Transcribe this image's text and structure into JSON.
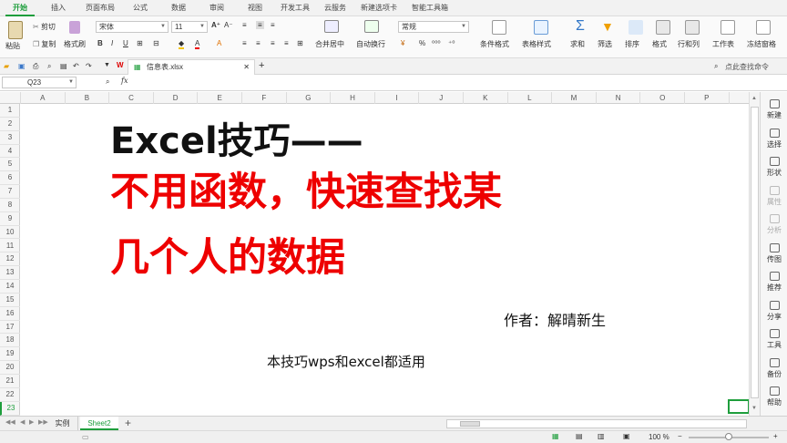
{
  "menu": {
    "tabs": [
      "开始",
      "插入",
      "页面布局",
      "公式",
      "数据",
      "审阅",
      "视图",
      "开发工具",
      "云服务",
      "新建选项卡",
      "智能工具箱"
    ]
  },
  "ribbon": {
    "paste": "粘贴",
    "cut": "剪切",
    "copy": "复制",
    "format_painter": "格式刷",
    "font_name": "宋体",
    "font_size": "11",
    "merge_center": "合并居中",
    "wrap_text": "自动换行",
    "number_format": "常规",
    "conditional_format": "条件格式",
    "table_style": "表格样式",
    "sum": "求和",
    "filter": "筛选",
    "sort": "排序",
    "format": "格式",
    "row_col": "行和列",
    "worksheet": "工作表",
    "freeze": "冻结窗格"
  },
  "docbar": {
    "filename": "信息表.xlsx",
    "search_placeholder": "点此查找命令"
  },
  "formula_bar": {
    "cell_ref": "Q23",
    "fx": "fx"
  },
  "grid": {
    "columns": [
      "A",
      "B",
      "C",
      "D",
      "E",
      "F",
      "G",
      "H",
      "I",
      "J",
      "K",
      "L",
      "M",
      "N",
      "O",
      "P"
    ],
    "rows": [
      "1",
      "2",
      "3",
      "4",
      "5",
      "6",
      "7",
      "8",
      "9",
      "10",
      "11",
      "12",
      "13",
      "14",
      "15",
      "16",
      "17",
      "18",
      "19",
      "20",
      "21",
      "22",
      "23"
    ]
  },
  "content": {
    "title_line1": "Excel技巧——",
    "title_line2": "不用函数，快速查找某",
    "title_line3": "几个人的数据",
    "author": "作者：解晴新生",
    "note": "本技巧wps和excel都适用"
  },
  "sidebar": {
    "items": [
      "新建",
      "选择",
      "形状",
      "属性",
      "分析",
      "传图",
      "推荐",
      "分享",
      "工具",
      "备份",
      "帮助"
    ]
  },
  "sheets": {
    "tabs": [
      "实例",
      "Sheet2"
    ],
    "active_index": 1
  },
  "status": {
    "zoom": "100 %"
  },
  "colors": {
    "accent_green": "#1e9e3c",
    "title_red": "#ee0000",
    "title_black": "#111111"
  }
}
